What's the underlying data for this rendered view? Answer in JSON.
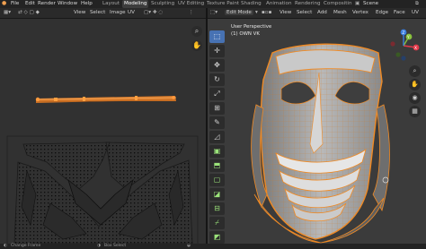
{
  "menubar": {
    "items": [
      "File",
      "Edit",
      "Render",
      "Window",
      "Help"
    ],
    "workspaces": [
      "Layout",
      "Modeling",
      "Sculpting",
      "UV Editing",
      "Texture Paint",
      "Shading",
      "Animation",
      "Rendering",
      "Compositin"
    ],
    "active_workspace": "Modeling",
    "scene_label": "Scene"
  },
  "uv_editor": {
    "header_items": [
      "View",
      "Select",
      "Image",
      "UV"
    ]
  },
  "viewport": {
    "mode_label": "Edit Mode",
    "header_items": [
      "View",
      "Select",
      "Add",
      "Mesh",
      "Vertex",
      "Edge",
      "Face",
      "UV"
    ],
    "perspective_label": "User Perspective",
    "object_label": "(1) OWN VK",
    "gizmo": {
      "x_label": "X",
      "y_label": "Y",
      "z_label": "Z"
    },
    "colors": {
      "x": "#e5394a",
      "y": "#8ac33d",
      "z": "#3b7fe0",
      "selection": "#f08a24"
    }
  },
  "toolbar": {
    "tools": [
      "select-box",
      "cursor",
      "move",
      "rotate",
      "scale",
      "transform",
      "annotate",
      "measure",
      "add-cube",
      "extrude",
      "inset",
      "bevel",
      "loop-cut",
      "knife",
      "poly-build",
      "spin",
      "smooth",
      "edge-slide",
      "shrink",
      "shear",
      "rip"
    ]
  },
  "statusbar": {
    "left": "Change Frame",
    "mid": "Box Select"
  }
}
